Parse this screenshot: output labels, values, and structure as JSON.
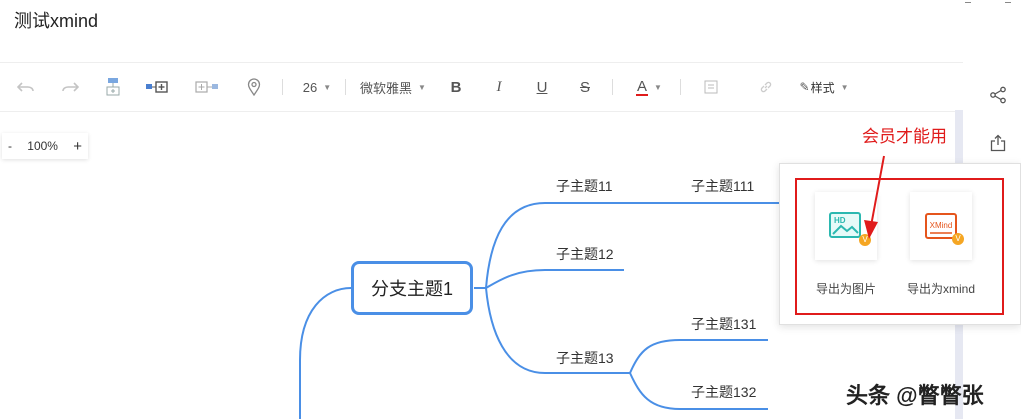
{
  "document": {
    "title": "测试xmind"
  },
  "toolbar": {
    "font_size": "26",
    "font_family": "微软雅黑",
    "bold": "B",
    "italic": "I",
    "underline": "U",
    "strike": "S",
    "font_color_glyph": "A",
    "font_color": "#e01b1b",
    "style_label": "样式"
  },
  "zoom": {
    "minus": "-",
    "level": "100%",
    "plus": "+"
  },
  "mindmap": {
    "branch": "分支主题1",
    "subtopics": {
      "t11": "子主题11",
      "t111": "子主题111",
      "t12": "子主题12",
      "t13": "子主题13",
      "t131": "子主题131",
      "t132": "子主题132"
    },
    "line_color": "#4a8fe6"
  },
  "export_menu": {
    "image_label": "导出为图片",
    "xmind_label": "导出为xmind",
    "image_thumb_text": "HD",
    "xmind_thumb_text": "XMind"
  },
  "annotation": {
    "text": "会员才能用"
  },
  "watermark": {
    "text": "头条 @瞥瞥张"
  }
}
